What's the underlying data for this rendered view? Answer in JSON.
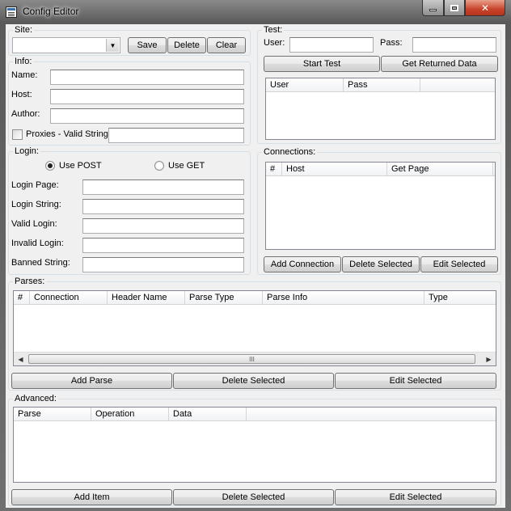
{
  "window": {
    "title": "Config Editor"
  },
  "site": {
    "legend": "Site:",
    "combo_value": "",
    "save_label": "Save",
    "delete_label": "Delete",
    "clear_label": "Clear"
  },
  "info": {
    "legend": "Info:",
    "name_label": "Name:",
    "host_label": "Host:",
    "author_label": "Author:",
    "proxies_label": "Proxies - Valid String",
    "name_value": "",
    "host_value": "",
    "author_value": "",
    "proxies_value": ""
  },
  "test": {
    "legend": "Test:",
    "user_label": "User:",
    "pass_label": "Pass:",
    "user_value": "",
    "pass_value": "",
    "start_label": "Start Test",
    "returned_label": "Get Returned Data",
    "columns": [
      "User",
      "Pass"
    ]
  },
  "login": {
    "legend": "Login:",
    "use_post_label": "Use POST",
    "use_get_label": "Use GET",
    "selected_method": "POST",
    "login_page_label": "Login Page:",
    "login_string_label": "Login String:",
    "valid_login_label": "Valid Login:",
    "invalid_login_label": "Invalid Login:",
    "banned_string_label": "Banned String:",
    "login_page_value": "",
    "login_string_value": "",
    "valid_login_value": "",
    "invalid_login_value": "",
    "banned_string_value": ""
  },
  "connections": {
    "legend": "Connections:",
    "columns": [
      "#",
      "Host",
      "Get Page"
    ],
    "add_label": "Add Connection",
    "delete_label": "Delete Selected",
    "edit_label": "Edit Selected"
  },
  "parses": {
    "legend": "Parses:",
    "columns": [
      "#",
      "Connection",
      "Header Name",
      "Parse Type",
      "Parse Info",
      "Type"
    ],
    "scroll_grip": "III",
    "add_label": "Add Parse",
    "delete_label": "Delete Selected",
    "edit_label": "Edit Selected"
  },
  "advanced": {
    "legend": "Advanced:",
    "columns": [
      "Parse",
      "Operation",
      "Data"
    ],
    "add_label": "Add Item",
    "delete_label": "Delete Selected",
    "edit_label": "Edit Selected"
  }
}
